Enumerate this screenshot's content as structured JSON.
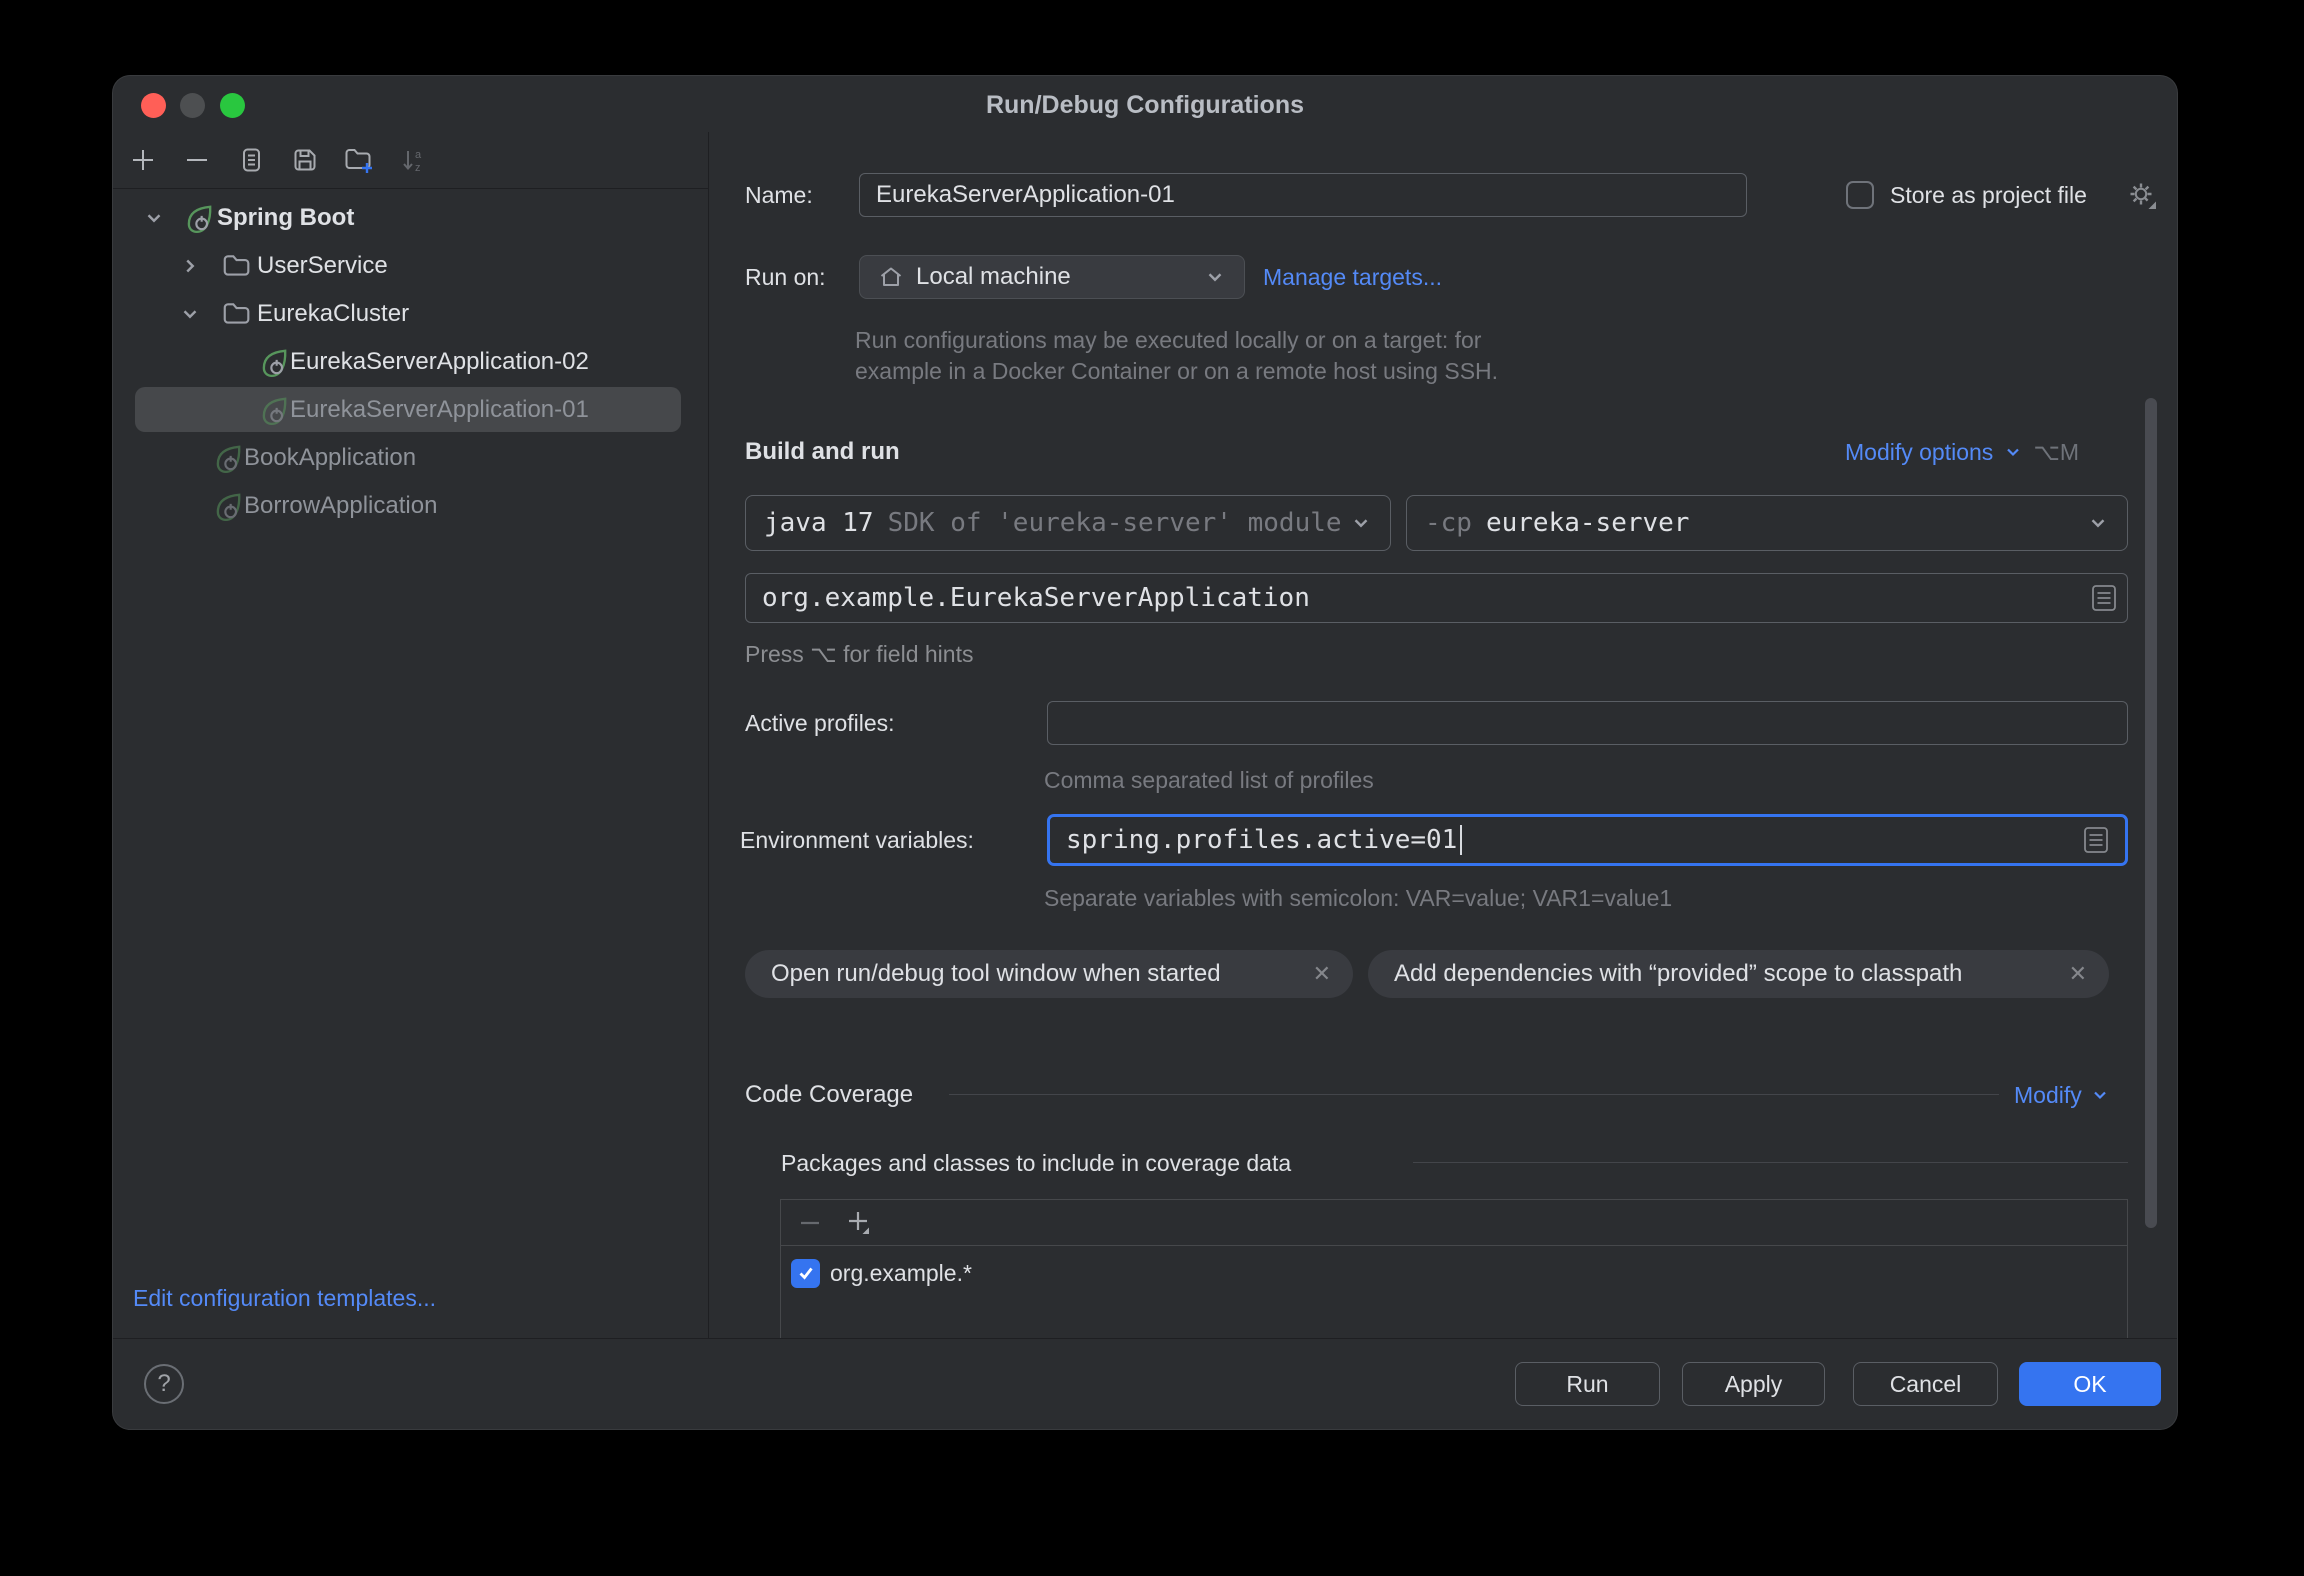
{
  "window_title": "Run/Debug Configurations",
  "sidebar": {
    "tree": [
      {
        "label": "Spring Boot"
      },
      {
        "label": "UserService"
      },
      {
        "label": "EurekaCluster"
      },
      {
        "label": "EurekaServerApplication-02"
      },
      {
        "label": "EurekaServerApplication-01"
      },
      {
        "label": "BookApplication"
      },
      {
        "label": "BorrowApplication"
      }
    ],
    "edit_templates_link": "Edit configuration templates..."
  },
  "form": {
    "name_label": "Name:",
    "name_value": "EurekaServerApplication-01",
    "store_as_project_file_label": "Store as project file",
    "run_on_label": "Run on:",
    "run_on_value": "Local machine",
    "manage_targets_link": "Manage targets...",
    "run_on_hint_line1": "Run configurations may be executed locally or on a target: for",
    "run_on_hint_line2": "example in a Docker Container or on a remote host using SSH.",
    "build_and_run": {
      "title": "Build and run",
      "modify_options_link": "Modify options",
      "modify_options_shortcut": "⌥M",
      "jdk_value": "java 17",
      "jdk_detail": "SDK of 'eureka-server' module",
      "cp_prefix": "-cp",
      "cp_value": "eureka-server",
      "main_class": "org.example.EurekaServerApplication"
    },
    "field_hints": "Press ⌥ for field hints",
    "active_profiles_label": "Active profiles:",
    "active_profiles_value": "",
    "active_profiles_helper": "Comma separated list of profiles",
    "env_label": "Environment variables:",
    "env_value": "spring.profiles.active=01",
    "env_helper": "Separate variables with semicolon: VAR=value; VAR1=value1",
    "chips": [
      {
        "label": "Open run/debug tool window when started"
      },
      {
        "label": "Add dependencies with “provided” scope to classpath"
      }
    ],
    "coverage": {
      "title": "Code Coverage",
      "modify_link": "Modify",
      "packages_label": "Packages and classes to include in coverage data",
      "rows": [
        {
          "label": "org.example.*",
          "checked": true
        }
      ]
    }
  },
  "footer": {
    "help": "?",
    "run": "Run",
    "apply": "Apply",
    "cancel": "Cancel",
    "ok": "OK"
  },
  "glyphs": {
    "close": "✕"
  },
  "colors": {
    "accent": "#3574F0",
    "link": "#548AF7",
    "spring_green": "#57965C"
  }
}
